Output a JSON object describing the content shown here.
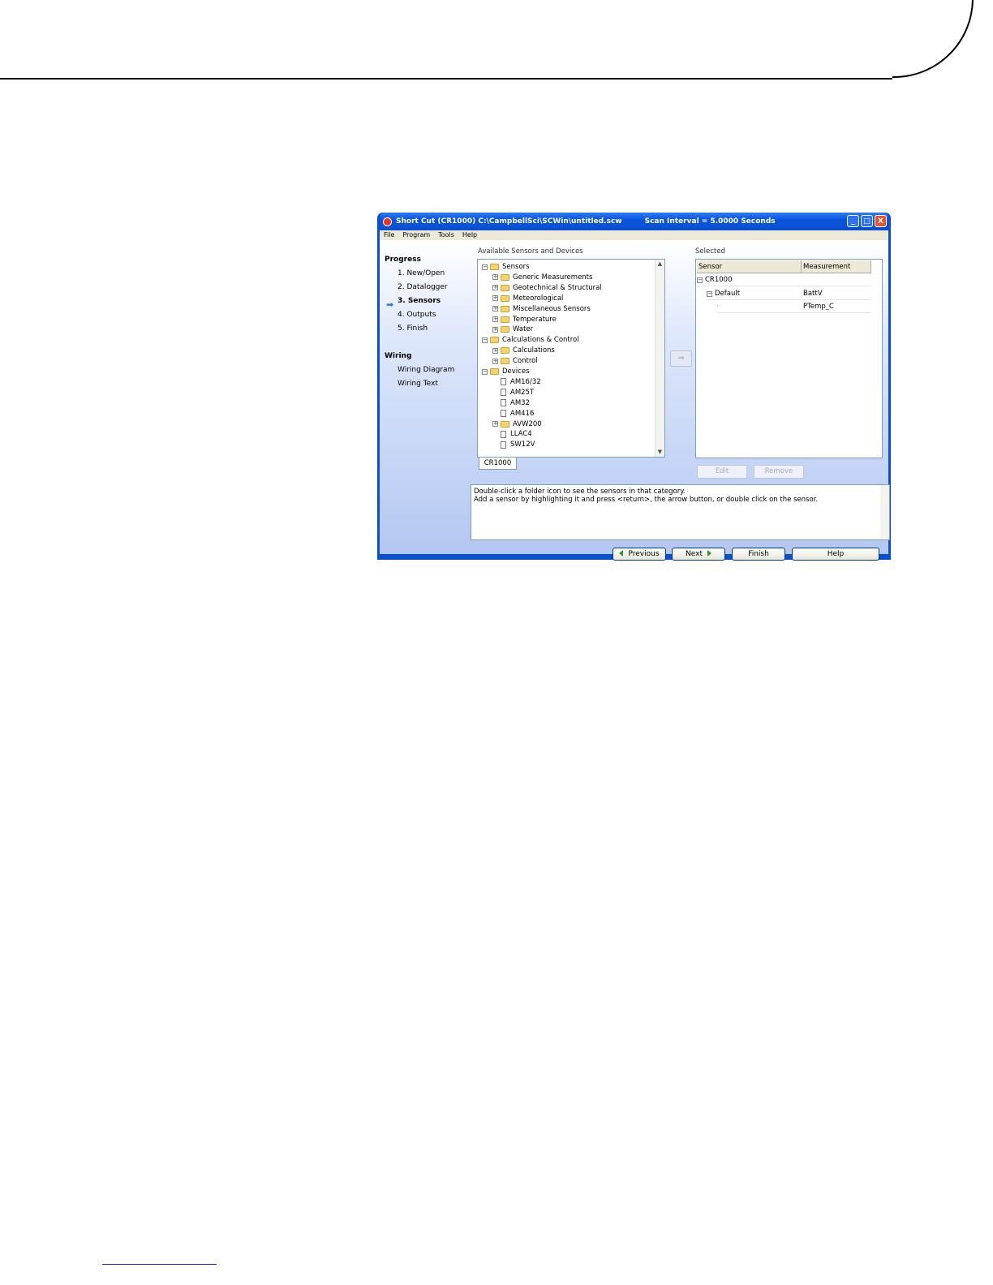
{
  "window": {
    "title": "Short Cut (CR1000) C:\\CampbellSci\\SCWin\\untitled.scw",
    "scan_interval": "Scan Interval = 5.0000 Seconds",
    "controls": {
      "minimize": "_",
      "maximize": "□",
      "close": "X"
    }
  },
  "menu": [
    "File",
    "Program",
    "Tools",
    "Help"
  ],
  "sidebar": {
    "progress_heading": "Progress",
    "progress_items": [
      "1. New/Open",
      "2. Datalogger",
      "3. Sensors",
      "4. Outputs",
      "5. Finish"
    ],
    "active_index": 2,
    "wiring_heading": "Wiring",
    "wiring_items": [
      "Wiring Diagram",
      "Wiring Text"
    ]
  },
  "available": {
    "label": "Available Sensors and Devices",
    "tree": [
      {
        "label": "Sensors",
        "level": 0,
        "kind": "folder",
        "expander": "minus"
      },
      {
        "label": "Generic Measurements",
        "level": 1,
        "kind": "folder",
        "expander": "plus"
      },
      {
        "label": "Geotechnical & Structural",
        "level": 1,
        "kind": "folder",
        "expander": "plus"
      },
      {
        "label": "Meteorological",
        "level": 1,
        "kind": "folder",
        "expander": "plus"
      },
      {
        "label": "Miscellaneous Sensors",
        "level": 1,
        "kind": "folder",
        "expander": "plus"
      },
      {
        "label": "Temperature",
        "level": 1,
        "kind": "folder",
        "expander": "plus"
      },
      {
        "label": "Water",
        "level": 1,
        "kind": "folder",
        "expander": "plus"
      },
      {
        "label": "Calculations & Control",
        "level": 0,
        "kind": "folder",
        "expander": "minus"
      },
      {
        "label": "Calculations",
        "level": 1,
        "kind": "folder",
        "expander": "plus"
      },
      {
        "label": "Control",
        "level": 1,
        "kind": "folder",
        "expander": "plus"
      },
      {
        "label": "Devices",
        "level": 0,
        "kind": "folder",
        "expander": "minus"
      },
      {
        "label": "AM16/32",
        "level": 1,
        "kind": "doc",
        "expander": ""
      },
      {
        "label": "AM25T",
        "level": 1,
        "kind": "doc",
        "expander": ""
      },
      {
        "label": "AM32",
        "level": 1,
        "kind": "doc",
        "expander": ""
      },
      {
        "label": "AM416",
        "level": 1,
        "kind": "doc",
        "expander": ""
      },
      {
        "label": "AVW200",
        "level": 1,
        "kind": "folder",
        "expander": "plus"
      },
      {
        "label": "LLAC4",
        "level": 1,
        "kind": "doc",
        "expander": ""
      },
      {
        "label": "SW12V",
        "level": 1,
        "kind": "doc",
        "expander": ""
      }
    ],
    "tab": "CR1000",
    "arrow_button": "⇒"
  },
  "selected": {
    "label": "Selected",
    "columns": [
      "Sensor",
      "Measurement"
    ],
    "rows": [
      {
        "sensor": "CR1000",
        "measurement": "",
        "level": 0
      },
      {
        "sensor": "Default",
        "measurement": "BattV",
        "level": 1
      },
      {
        "sensor": "",
        "measurement": "PTemp_C",
        "level": 2
      }
    ],
    "edit_label": "Edit",
    "remove_label": "Remove"
  },
  "info": {
    "line1": "Double-click a folder icon to see the sensors in that category.",
    "line2": "Add a sensor by highlighting it and press <return>, the arrow button, or double click on the sensor."
  },
  "nav": {
    "previous": "Previous",
    "next": "Next",
    "finish": "Finish",
    "help": "Help"
  }
}
